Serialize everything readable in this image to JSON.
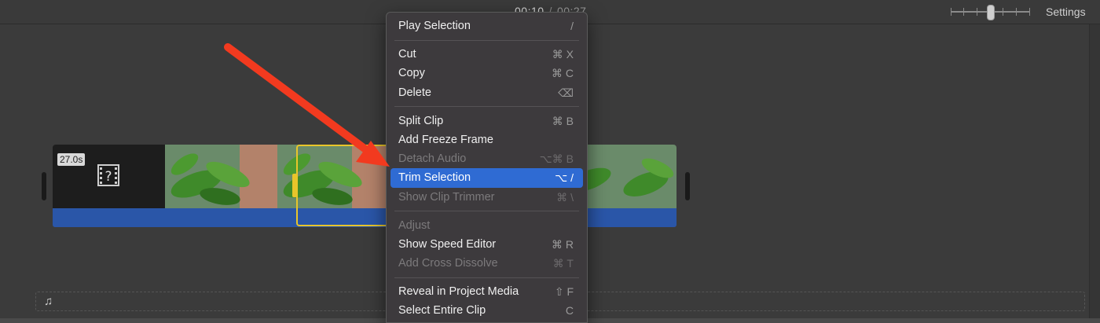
{
  "toolbar": {
    "timecode_current": "00:10",
    "timecode_separator": "/",
    "timecode_total": "00:27",
    "zoom_level": 0.5,
    "settings_label": "Settings"
  },
  "clip": {
    "duration": "27.0s",
    "missing_media_icon": "film-question-icon"
  },
  "music_well": {
    "icon": "music-note-icon",
    "glyph": "♫"
  },
  "context_menu": {
    "items": [
      {
        "label": "Play Selection",
        "shortcut": "/",
        "enabled": true
      },
      {
        "label": "Cut",
        "shortcut": "⌘ X",
        "enabled": true
      },
      {
        "label": "Copy",
        "shortcut": "⌘ C",
        "enabled": true
      },
      {
        "label": "Delete",
        "shortcut": "⌫",
        "enabled": true
      },
      {
        "label": "Split Clip",
        "shortcut": "⌘ B",
        "enabled": true
      },
      {
        "label": "Add Freeze Frame",
        "shortcut": "",
        "enabled": true
      },
      {
        "label": "Detach Audio",
        "shortcut": "⌥⌘ B",
        "enabled": false
      },
      {
        "label": "Trim Selection",
        "shortcut": "⌥  /",
        "enabled": true,
        "highlighted": true
      },
      {
        "label": "Show Clip Trimmer",
        "shortcut": "⌘ \\",
        "enabled": false
      },
      {
        "label": "Adjust",
        "shortcut": "",
        "enabled": false
      },
      {
        "label": "Show Speed Editor",
        "shortcut": "⌘ R",
        "enabled": true
      },
      {
        "label": "Add Cross Dissolve",
        "shortcut": "⌘ T",
        "enabled": false
      },
      {
        "label": "Reveal in Project Media",
        "shortcut": "⇧ F",
        "enabled": true
      },
      {
        "label": "Select Entire Clip",
        "shortcut": "C",
        "enabled": true
      }
    ]
  },
  "colors": {
    "menu_highlight": "#2f6bd3",
    "selection_border": "#e8c52a",
    "audio_bar": "#2a56a8",
    "annotation_arrow": "#f23a1f"
  }
}
